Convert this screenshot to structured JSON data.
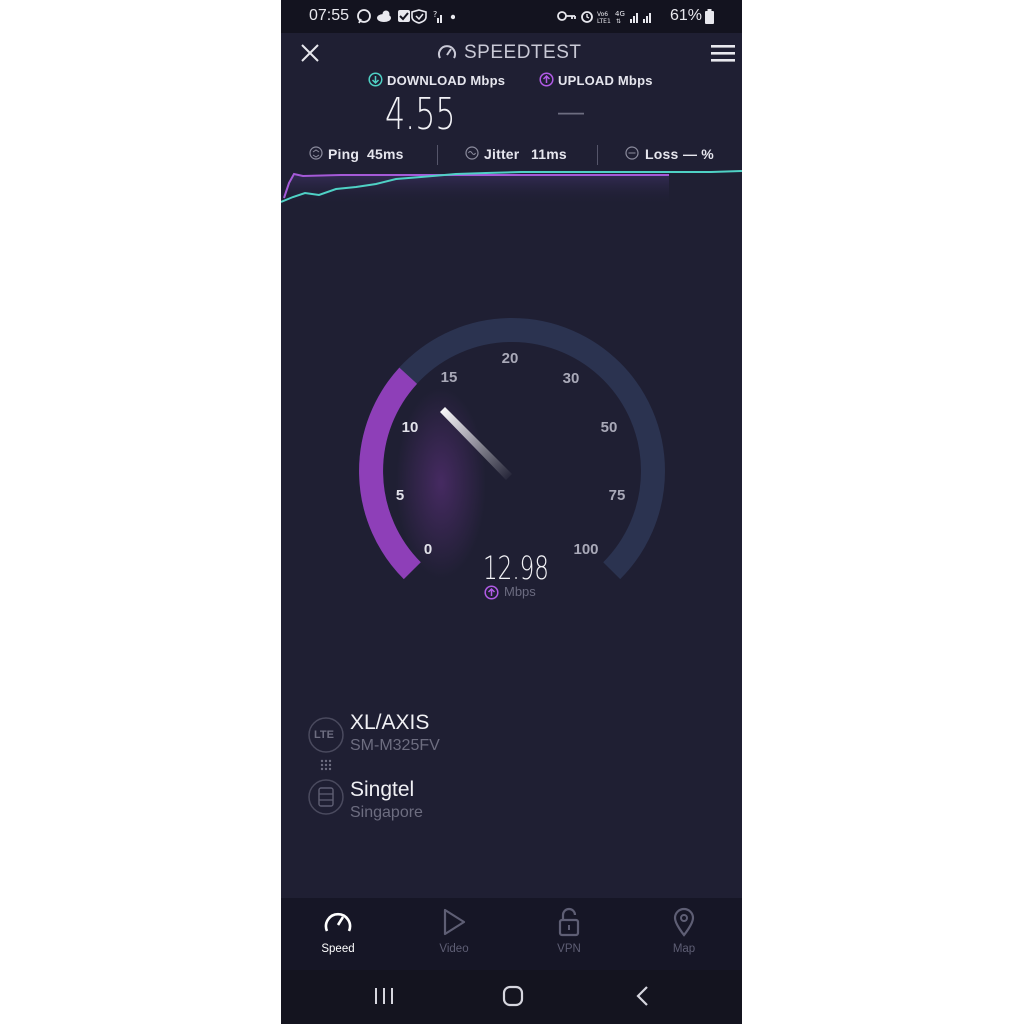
{
  "status_bar": {
    "time": "07:55",
    "battery": "61%",
    "left_icons": [
      "whatsapp-icon",
      "cloud-icon",
      "checkbox-icon",
      "shield-icon",
      "signal-small-icon",
      "dot-icon"
    ],
    "right_icons": [
      "key-icon",
      "alarm-icon",
      "volte-icon",
      "4g-icon",
      "signal-icon",
      "signal-icon",
      "battery-icon"
    ]
  },
  "header": {
    "title": "SPEEDTEST"
  },
  "results": {
    "download_label": "DOWNLOAD Mbps",
    "upload_label": "UPLOAD Mbps",
    "download_value": "4.55",
    "upload_value": "—"
  },
  "metrics": {
    "ping_label": "Ping",
    "ping_value": "45ms",
    "jitter_label": "Jitter",
    "jitter_value": "11ms",
    "loss_label": "Loss",
    "loss_value": "— %"
  },
  "gauge": {
    "ticks": [
      "0",
      "5",
      "10",
      "15",
      "20",
      "30",
      "50",
      "75",
      "100"
    ],
    "current_value": "12.98",
    "unit": "Mbps",
    "mode": "upload",
    "level": 12.98,
    "colors": {
      "track": "#2b3350",
      "fill": "#8e3fb8",
      "needle": "#ffffff"
    }
  },
  "connection": {
    "provider": "XL/AXIS",
    "device": "SM-M325FV",
    "server_name": "Singtel",
    "server_location": "Singapore",
    "provider_badge": "LTE"
  },
  "bottom_nav": [
    {
      "label": "Speed",
      "icon": "speedometer-icon",
      "active": true
    },
    {
      "label": "Video",
      "icon": "play-icon",
      "active": false
    },
    {
      "label": "VPN",
      "icon": "lock-icon",
      "active": false
    },
    {
      "label": "Map",
      "icon": "map-pin-icon",
      "active": false
    }
  ],
  "colors": {
    "background": "#1f1f33",
    "download_accent": "#4fd1c5",
    "upload_accent": "#b15be6"
  }
}
